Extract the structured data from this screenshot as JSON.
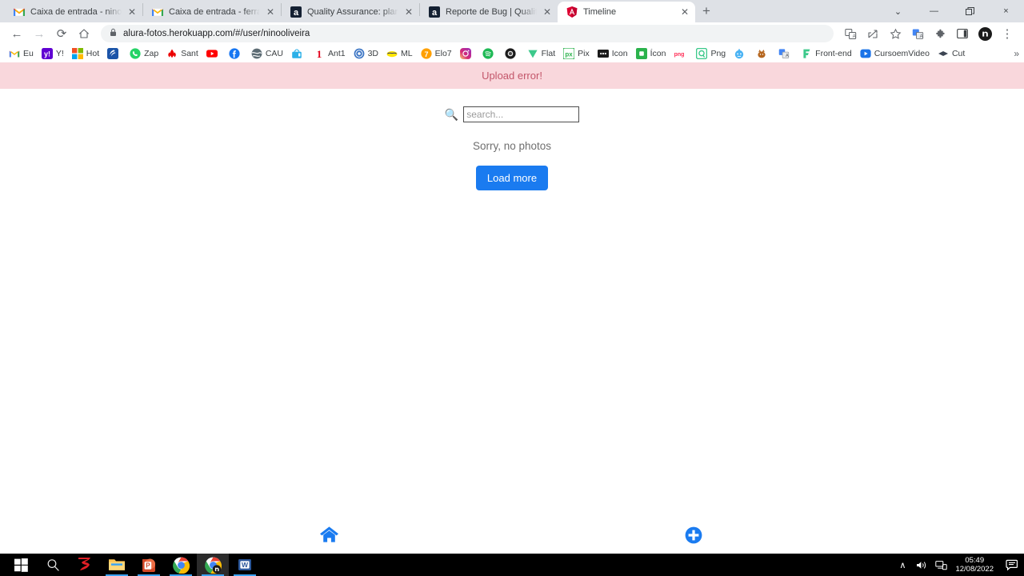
{
  "browser": {
    "tabs": [
      {
        "title": "Caixa de entrada - ninoarquitetos",
        "favicon": "gmail-icon",
        "active": false
      },
      {
        "title": "Caixa de entrada - ferramentasde",
        "favicon": "gmail-icon",
        "active": false
      },
      {
        "title": "Quality Assurance: plano de teste",
        "favicon": "alura-icon",
        "active": false
      },
      {
        "title": "Reporte de Bug | Quality Assuran",
        "favicon": "alura-icon",
        "active": false
      },
      {
        "title": "Timeline",
        "favicon": "angular-icon",
        "active": true
      }
    ],
    "new_tab_label": "+",
    "window_controls": {
      "minimize_group": "⌄",
      "minimize": "—",
      "maximize": "❐",
      "close": "×"
    },
    "nav": {
      "back": "←",
      "forward": "→",
      "reload": "⟳",
      "home": "⌂"
    },
    "omnibox": {
      "lock_icon": "lock-icon",
      "url_domain": "alura-fotos.herokuapp.com",
      "url_path": "/#/user/ninooliveira",
      "full_url": "alura-fotos.herokuapp.com/#/user/ninooliveira"
    },
    "toolbar_icons": [
      "translate-icon",
      "share-icon",
      "bookmark-star-icon",
      "extension-translate-icon",
      "extensions-puzzle-icon",
      "sidepanel-icon",
      "profile-avatar-icon",
      "chrome-menu-icon"
    ],
    "bookmarks": [
      {
        "label": "Eu",
        "icon": "gmail-icon"
      },
      {
        "label": "Y!",
        "icon": "yahoo-icon"
      },
      {
        "label": "Hot",
        "icon": "microsoft-icon"
      },
      {
        "label": "",
        "icon": "bank-icon"
      },
      {
        "label": "Zap",
        "icon": "whatsapp-icon"
      },
      {
        "label": "Sant",
        "icon": "santander-icon"
      },
      {
        "label": "",
        "icon": "youtube-icon"
      },
      {
        "label": "",
        "icon": "facebook-icon"
      },
      {
        "label": "CAU",
        "icon": "globe-icon"
      },
      {
        "label": "",
        "icon": "tv-icon"
      },
      {
        "label": "Ant1",
        "icon": "one-icon"
      },
      {
        "label": "3D",
        "icon": "target-icon"
      },
      {
        "label": "ML",
        "icon": "mercadolivre-icon"
      },
      {
        "label": "Elo7",
        "icon": "elo7-icon"
      },
      {
        "label": "",
        "icon": "instagram-icon"
      },
      {
        "label": "",
        "icon": "spotify-icon"
      },
      {
        "label": "",
        "icon": "camera-icon"
      },
      {
        "label": "Flat",
        "icon": "flaticon-icon"
      },
      {
        "label": "Pix",
        "icon": "pixabay-icon"
      },
      {
        "label": "Icon",
        "icon": "iconfinder-icon"
      },
      {
        "label": "Ícon",
        "icon": "icon-green-icon"
      },
      {
        "label": "",
        "icon": "png-red-icon"
      },
      {
        "label": "Png",
        "icon": "pngtree-icon"
      },
      {
        "label": "",
        "icon": "reddit-icon"
      },
      {
        "label": "",
        "icon": "squirrel-icon"
      },
      {
        "label": "",
        "icon": "translate-blue-icon"
      },
      {
        "label": "Front-end",
        "icon": "f-green-icon"
      },
      {
        "label": "CursoemVideo",
        "icon": "play-blue-icon"
      },
      {
        "label": "Cut",
        "icon": "diamond-icon"
      }
    ],
    "bookmarks_overflow": "»"
  },
  "page": {
    "alert": {
      "message": "Upload error!",
      "bg": "#f9d7dc",
      "color": "#c3566a"
    },
    "search": {
      "icon": "search-icon",
      "value": "",
      "placeholder": "search..."
    },
    "empty_state": "Sorry, no photos",
    "load_more_label": "Load more",
    "load_more_color": "#1a7bf0",
    "bottom_nav": [
      {
        "name": "home-icon",
        "color": "#1a7bf0"
      },
      {
        "name": "add-photo-icon",
        "color": "#1a7bf0"
      }
    ]
  },
  "taskbar": {
    "start": "windows-start-icon",
    "items": [
      {
        "name": "search-icon",
        "running": false
      },
      {
        "name": "sketchup-icon",
        "running": false
      },
      {
        "name": "file-explorer-icon",
        "running": true
      },
      {
        "name": "powerpoint-icon",
        "running": true
      },
      {
        "name": "chrome-icon",
        "running": true
      },
      {
        "name": "chrome-profile-icon",
        "running": true,
        "active": true
      },
      {
        "name": "word-icon",
        "running": true
      }
    ],
    "tray": {
      "show_hidden": "∧",
      "volume": "volume-icon",
      "network": "network-icon",
      "time": "05:49",
      "date": "12/08/2022",
      "notifications": "notification-icon"
    }
  }
}
